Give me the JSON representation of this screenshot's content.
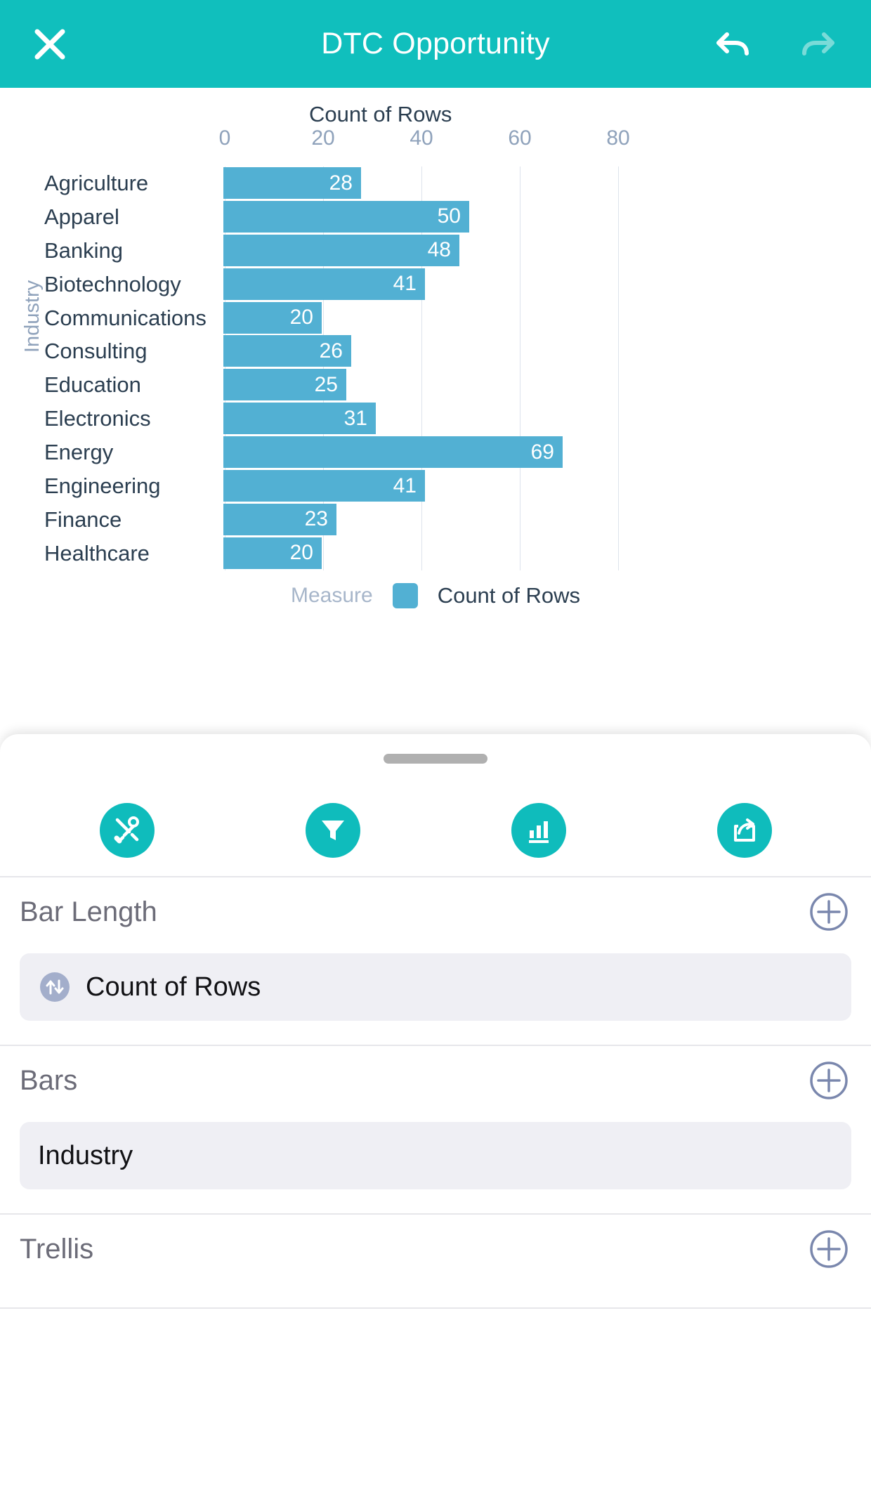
{
  "header": {
    "title": "DTC Opportunity",
    "close_icon": "close-icon",
    "undo_icon": "undo-icon",
    "redo_icon": "redo-icon"
  },
  "chart_data": {
    "type": "bar",
    "orientation": "horizontal",
    "title": "Count of Rows",
    "xlabel": "Count of Rows",
    "ylabel": "Industry",
    "categories": [
      "Agriculture",
      "Apparel",
      "Banking",
      "Biotechnology",
      "Communications",
      "Consulting",
      "Education",
      "Electronics",
      "Energy",
      "Engineering",
      "Finance",
      "Healthcare"
    ],
    "values": [
      28,
      50,
      48,
      41,
      20,
      26,
      25,
      31,
      69,
      41,
      23,
      20
    ],
    "xticks": [
      0,
      20,
      40,
      60,
      80
    ],
    "xlim": [
      0,
      80
    ],
    "grid": true,
    "bar_color": "#52b0d3",
    "legend": {
      "position": "bottom",
      "caption": "Measure",
      "entries": [
        {
          "label": "Count of Rows",
          "color": "#52b0d3"
        }
      ]
    }
  },
  "sheet": {
    "toolbar": [
      {
        "name": "tools-icon",
        "label": "Tools"
      },
      {
        "name": "filter-icon",
        "label": "Filter"
      },
      {
        "name": "chart-icon",
        "label": "Chart"
      },
      {
        "name": "share-icon",
        "label": "Share"
      }
    ],
    "sections": [
      {
        "title": "Bar Length",
        "add_icon": "plus-circle-icon",
        "chips": [
          {
            "label": "Count of Rows",
            "icon": "measure-arrows-icon"
          }
        ]
      },
      {
        "title": "Bars",
        "add_icon": "plus-circle-icon",
        "chips": [
          {
            "label": "Industry",
            "icon": null
          }
        ]
      },
      {
        "title": "Trellis",
        "add_icon": "plus-circle-icon",
        "chips": []
      }
    ]
  },
  "colors": {
    "brand_teal": "#10bfbd",
    "bar_blue": "#52b0d3",
    "axis_text": "#8fa2bb",
    "label_text": "#2b3e50",
    "chip_bg": "#efeff4",
    "plus_stroke": "#7a87ad"
  }
}
